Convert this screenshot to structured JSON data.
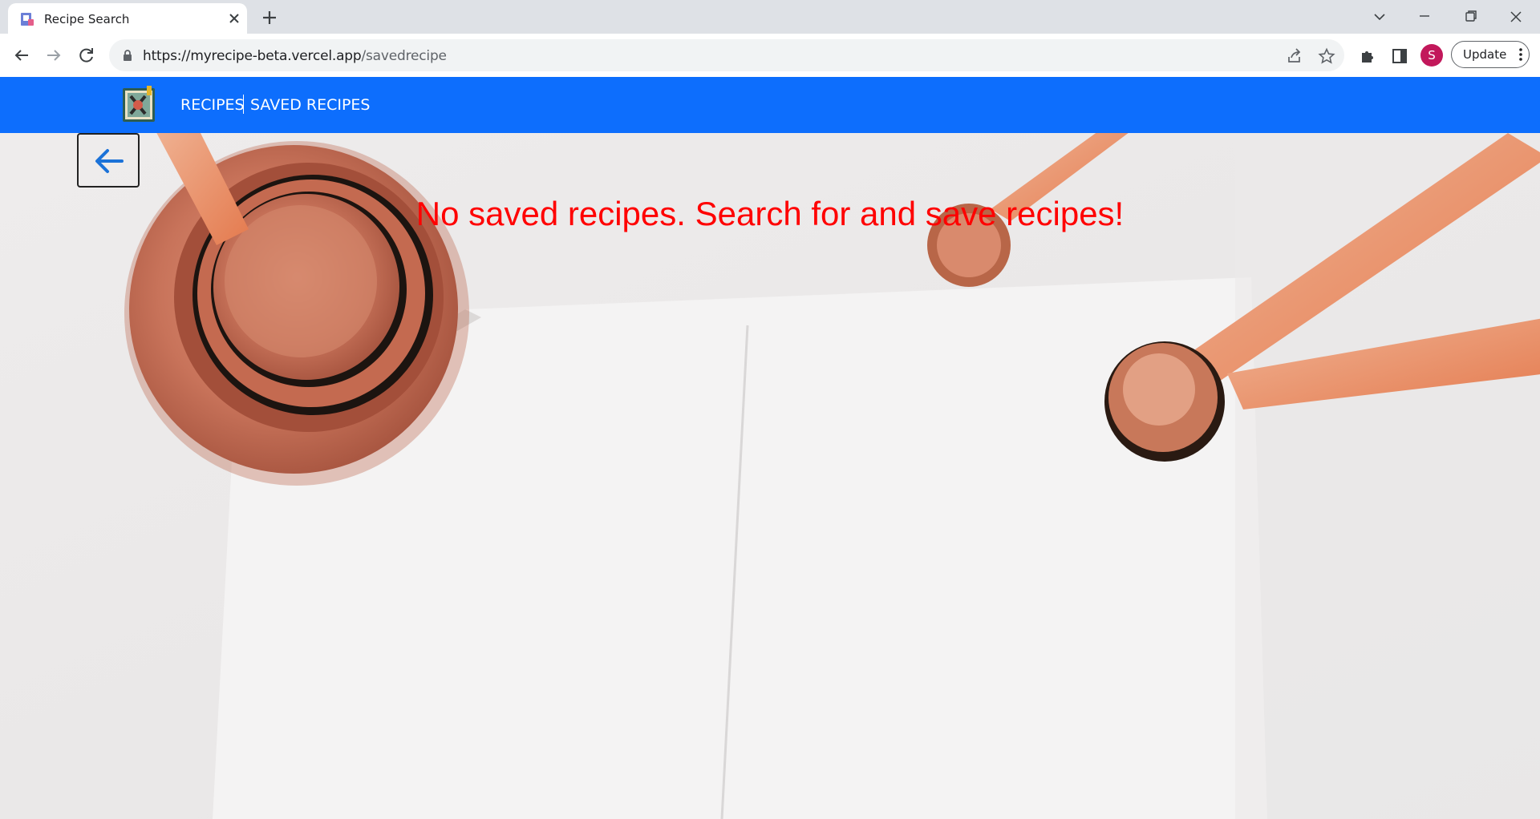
{
  "browser": {
    "tab_title": "Recipe Search",
    "url_host": "https://myrecipe-beta.vercel.app",
    "url_path": "/savedrecipe",
    "profile_initial": "S",
    "update_label": "Update",
    "icons": [
      "recipe-favicon",
      "close-icon",
      "plus-icon",
      "chevron-down-icon",
      "minimize-icon",
      "restore-icon",
      "close-window-icon",
      "back-arrow-icon",
      "forward-arrow-icon",
      "reload-icon",
      "lock-icon",
      "share-icon",
      "star-icon",
      "puzzle-icon",
      "side-panel-icon",
      "more-vert-icon"
    ]
  },
  "navbar": {
    "links": [
      {
        "label": "RECIPES"
      },
      {
        "label": "SAVED RECIPES"
      }
    ],
    "color": "#0d6efd"
  },
  "main": {
    "empty_message": "No saved recipes. Search for and save recipes!",
    "message_color": "#ff0000"
  }
}
